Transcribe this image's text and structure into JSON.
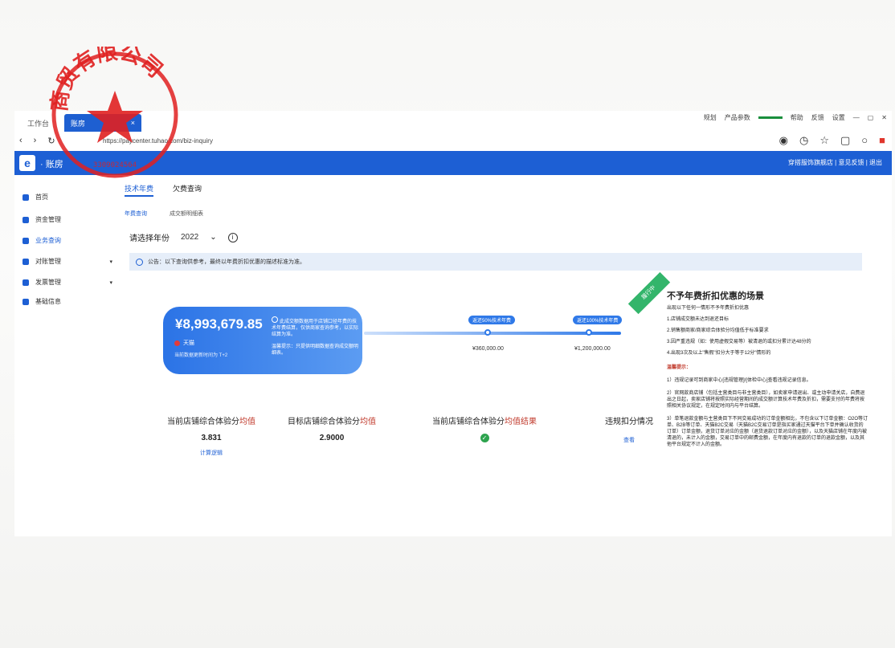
{
  "browser": {
    "tabs": [
      {
        "label": "工作台"
      },
      {
        "label": "账房"
      }
    ],
    "topright": [
      "规划",
      "产品参数",
      "帮助",
      "反馈",
      "设置"
    ],
    "url": "https://paycenter.tuhao.com/biz-inquiry"
  },
  "seal": {
    "text": "商贸有限公司",
    "code": "3309024564"
  },
  "app": {
    "title": "· 账房",
    "header_links": "穿搭服饰旗舰店 | 意见反馈 | 退出"
  },
  "sidebar": {
    "items": [
      {
        "label": "首页"
      },
      {
        "label": "资金管理"
      },
      {
        "label": "业务查询"
      },
      {
        "label": "对账管理"
      },
      {
        "label": "发票管理"
      },
      {
        "label": "基础信息"
      }
    ]
  },
  "main": {
    "tabs": [
      "技术年费",
      "欠费查询"
    ],
    "subtabs": [
      "年费查询",
      "成交额明细表"
    ],
    "year_label": "请选择年份",
    "year_value": "2022",
    "notice": "公告：以下查询供参考，最终以年费折扣优惠的描述标准为准。",
    "card": {
      "amount": "¥8,993,679.85",
      "tag": "天猫",
      "note": "当前数据更新时间为 T+2",
      "desc": "此成交额数据用于店铺口径年费的技术年费结算，仅供商家查询参考，以实际结算为准。",
      "tip": "温馨提示：只提供明细数据查询成交额明细表。"
    },
    "progress": {
      "labels": [
        "返还50%技术年费",
        "返还100%技术年费"
      ],
      "values": [
        "¥360,000.00",
        "¥1,200,000.00"
      ],
      "ribbon": "履行中"
    },
    "metrics": [
      {
        "title": "当前店铺综合体验分",
        "title_em": "均值",
        "value": "3.831",
        "link": "计算逻辑"
      },
      {
        "title": "目标店铺综合体验分",
        "title_em": "均值",
        "value": "2.9000",
        "link": ""
      },
      {
        "title": "当前店铺综合体验分",
        "title_em": "均值结果",
        "value": "",
        "link": ""
      },
      {
        "title": "违规扣分情况",
        "title_em": "",
        "value": "",
        "link": "查看"
      }
    ]
  },
  "panel": {
    "title": "不予年费折扣优惠的场景",
    "sub": "出现以下任何一情形不予年费折扣优惠",
    "items": [
      "1.店铺成交额未达到退还目标",
      "2.销售额商家/商家综合体验分均值低于标准要求",
      "3.因严重违规（如：使用虚假交易等）被清退的或扣分累计达48分的",
      "4.出现3次及以上\"售假\"扣分大于等于12分\"情形的"
    ],
    "warn": "温馨提示：",
    "paras": [
      "1）违规记录可到商家中心[违规管理]/[体检中心]查看违规记录信息。",
      "2）官网款商店铺（包括主营类目与非主营类目），如卖家申请退出、或主动申请关店，自费退出之日起，卖家店铺将按照实际经营期间的成交额计算技术年费及折扣，需要支付的年费将按照相关协议规定，在规定时间内与平台结算。",
      "3）单笔退款金额与主营类目下不同交易成功的订单金额相比，不包含以下订单金额：O2O等订单、B2B等订单、天猫B2C交易（天猫B2C交易订单是指买家通过天猫平台下单并确认收货的订单）订单金额，退货订单对应的金额（退货退款订单对应的金额），以及天猫店铺在年度内被清退的，未计入的金额，交易订单中的邮费金额，在年度内有退款的订单的退款金额，以及其他平台规定不计入的金额。"
    ]
  }
}
